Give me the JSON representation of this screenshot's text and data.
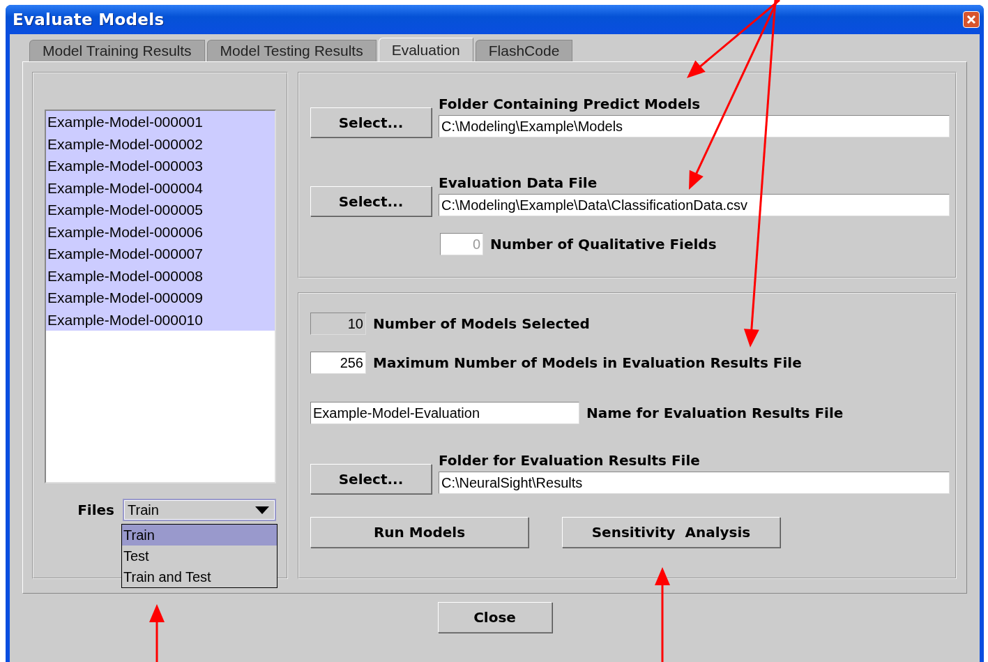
{
  "window": {
    "title": "Evaluate Models"
  },
  "tabs": [
    {
      "label": "Model Training Results",
      "selected": false
    },
    {
      "label": "Model Testing Results",
      "selected": false
    },
    {
      "label": "Evaluation",
      "selected": true
    },
    {
      "label": "FlashCode",
      "selected": false
    }
  ],
  "model_list": [
    {
      "label": "Example-Model-000001",
      "selected": true
    },
    {
      "label": "Example-Model-000002",
      "selected": true
    },
    {
      "label": "Example-Model-000003",
      "selected": true
    },
    {
      "label": "Example-Model-000004",
      "selected": true
    },
    {
      "label": "Example-Model-000005",
      "selected": true
    },
    {
      "label": "Example-Model-000006",
      "selected": true
    },
    {
      "label": "Example-Model-000007",
      "selected": true
    },
    {
      "label": "Example-Model-000008",
      "selected": true
    },
    {
      "label": "Example-Model-000009",
      "selected": true
    },
    {
      "label": "Example-Model-000010",
      "selected": true
    }
  ],
  "files": {
    "label": "Files",
    "value": "Train",
    "expanded": true,
    "options": [
      {
        "label": "Train",
        "selected": true
      },
      {
        "label": "Test",
        "selected": false
      },
      {
        "label": "Train and Test",
        "selected": false
      }
    ]
  },
  "predict_models": {
    "button": "Select...",
    "label": "Folder Containing Predict Models",
    "value": "C:\\Modeling\\Example\\Models"
  },
  "evaluation_data": {
    "button": "Select...",
    "label": "Evaluation Data File",
    "value": "C:\\Modeling\\Example\\Data\\ClassificationData.csv"
  },
  "qualitative_fields": {
    "value": "0",
    "label": "Number of Qualitative Fields",
    "disabled": true
  },
  "models_selected": {
    "value": "10",
    "label": "Number of Models Selected",
    "disabled": true
  },
  "max_models": {
    "value": "256",
    "label": "Maximum Number of Models in Evaluation Results File",
    "disabled": false
  },
  "results_name": {
    "value": "Example-Model-Evaluation",
    "label": "Name for Evaluation Results File"
  },
  "results_folder": {
    "button": "Select...",
    "label": "Folder for Evaluation Results File",
    "value": "C:\\NeuralSight\\Results"
  },
  "actions": [
    "Run Models",
    "Sensitivity  Analysis"
  ],
  "close_button": "Close"
}
